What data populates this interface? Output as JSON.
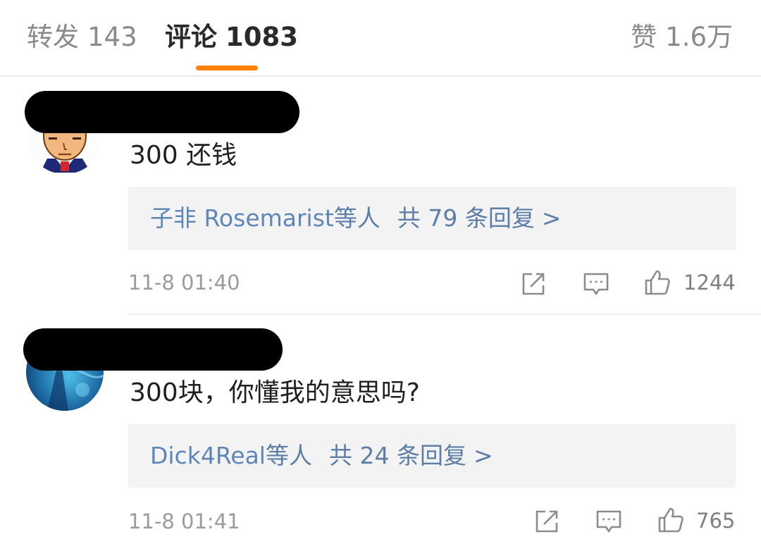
{
  "tabs": {
    "reposts": {
      "label": "转发",
      "count": "143"
    },
    "comments": {
      "label": "评论",
      "count": "1083"
    },
    "likes": {
      "label": "赞",
      "count": "1.6万"
    },
    "accent_color": "#ff8200"
  },
  "comments": [
    {
      "text": "300 还钱",
      "replies": {
        "users": "子非 Rosemarist",
        "suffix": "等人",
        "total": "共 79 条回复",
        "arrow": ">"
      },
      "time": "11-8 01:40",
      "likes": "1244",
      "icons": [
        "share-icon",
        "comment-icon",
        "thumbs-up-icon"
      ]
    },
    {
      "text": "300块，你懂我的意思吗?",
      "replies": {
        "users": "Dick4Real",
        "suffix": "等人",
        "total": "共 24 条回复",
        "arrow": ">"
      },
      "time": "11-8 01:41",
      "likes": "765",
      "icons": [
        "share-icon",
        "comment-icon",
        "thumbs-up-icon"
      ]
    }
  ]
}
